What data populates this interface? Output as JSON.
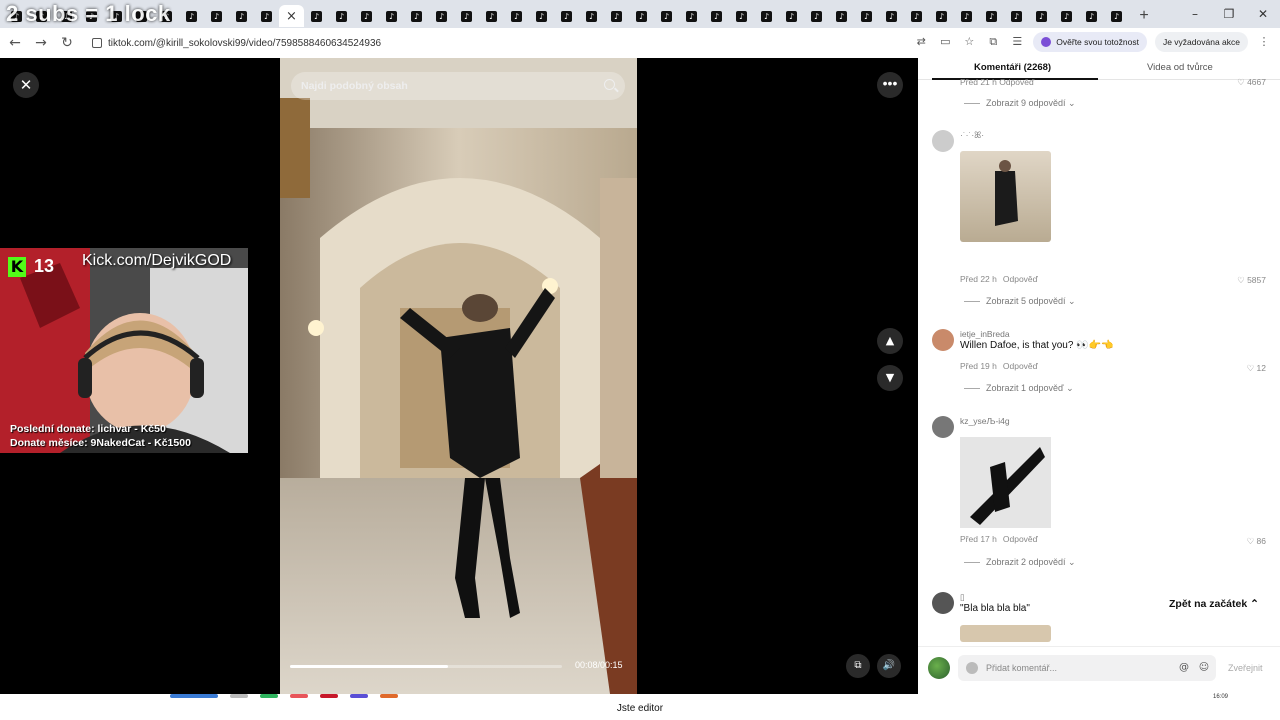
{
  "overlay_title": "2 subs = 1 lock",
  "browser": {
    "tabs": [
      "♪",
      "♪",
      "♪",
      "♪",
      "♪",
      "♪",
      "♪",
      "♪",
      "♪",
      "♪",
      "♪",
      "♪",
      "♪",
      "♪",
      "♪",
      "♪",
      "♪",
      "♪",
      "♪",
      "♪",
      "♪",
      "♪",
      "♪",
      "♪",
      "♪",
      "♪",
      "♪",
      "♪",
      "♪",
      "♪",
      "♪",
      "♪",
      "♪",
      "♪",
      "♪",
      "♪",
      "♪",
      "♪",
      "♪",
      "♪",
      "♪",
      "♪",
      "♪",
      "♪"
    ],
    "active_tab_close": "×",
    "new_tab": "+",
    "window": {
      "minimize": "–",
      "restore": "❐",
      "close": "✕"
    },
    "nav": {
      "back": "←",
      "forward": "→",
      "reload": "↻"
    },
    "url": "tiktok.com/@kirill_sokolovski99/video/7598588460634524936",
    "verify_label": "Ověřte svou totožnost",
    "action_label": "Je vyžadována akce"
  },
  "video": {
    "search_placeholder": "Najdi podobný obsah",
    "close": "✕",
    "more": "•••",
    "up": "▲",
    "down": "▼",
    "pip": "⧉",
    "volume": "🔊",
    "time": "00:08/00:15",
    "progress_fraction": 0.58
  },
  "streamer": {
    "kick_count": "13",
    "kick_letter": "K",
    "kick_url": "Kick.com/DejvikGOD",
    "donate_last": "Poslední donate: lichvar - Kč50",
    "donate_month": "Donate měsíce: 9NakedCat - Kč1500"
  },
  "sidebar": {
    "tab_comments": "Komentáři (2268)",
    "tab_videos": "Videa od tvůrce",
    "top_meta": "Před 21 h   Odpověď",
    "top_like": "♡ 4667",
    "top_replies": "Zobrazit 9 odpovědí ⌄",
    "comments": [
      {
        "user": "·˙·˙·ꕤ·",
        "text": "",
        "meta_time": "Před 22 h",
        "reply": "Odpověď",
        "likes": "♡ 5857",
        "replies": "Zobrazit 5 odpovědí ⌄"
      },
      {
        "user": "ietje_inBreda",
        "text": "Willen Dafoe, is that you? 👀👉👈",
        "meta_time": "Před 19 h",
        "reply": "Odpověď",
        "likes": "♡ 12",
        "replies": "Zobrazit 1 odpověď ⌄"
      },
      {
        "user": "kz_yseЉ-i4g",
        "text": "",
        "meta_time": "Před 17 h",
        "reply": "Odpověď",
        "likes": "♡ 86",
        "replies": "Zobrazit 2 odpovědí ⌄"
      },
      {
        "user": "▯",
        "text": "\"Bla bla bla bla\"",
        "meta_time": "",
        "reply": "",
        "likes": "",
        "replies": ""
      }
    ],
    "back_to_top": "Zpět na začátek ⌃",
    "input_placeholder": "Přidat komentář...",
    "at": "@",
    "emoji": "☺",
    "post": "Zveřejnit"
  },
  "taskbar": {
    "label": "Jste editor",
    "clock": "16:09"
  }
}
